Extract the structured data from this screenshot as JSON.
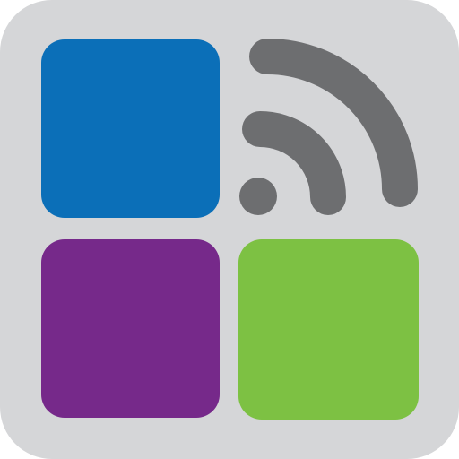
{
  "icon": {
    "name": "rss-grid-app-icon",
    "background_color": "#d5d6d8",
    "tiles": {
      "top_left_color": "#0b6fb8",
      "bottom_left_color": "#76298a",
      "bottom_right_color": "#7dc143"
    },
    "feed_symbol": {
      "icon": "rss-feed-icon",
      "color": "#6d6e70"
    }
  }
}
